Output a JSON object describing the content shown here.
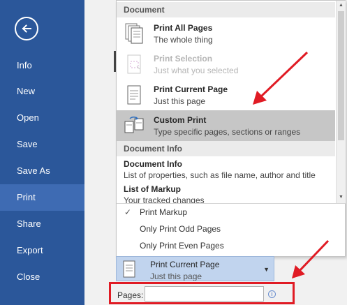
{
  "sidebar": {
    "back_label": "Back",
    "items": [
      {
        "label": "Info"
      },
      {
        "label": "New"
      },
      {
        "label": "Open"
      },
      {
        "label": "Save"
      },
      {
        "label": "Save As"
      },
      {
        "label": "Print",
        "active": true
      },
      {
        "label": "Share"
      },
      {
        "label": "Export"
      },
      {
        "label": "Close"
      }
    ]
  },
  "dropdown": {
    "sections": [
      {
        "heading": "Document",
        "options": [
          {
            "title": "Print All Pages",
            "subtitle": "The whole thing",
            "icon": "all-pages-icon"
          },
          {
            "title": "Print Selection",
            "subtitle": "Just what you selected",
            "icon": "selection-icon",
            "disabled": true
          },
          {
            "title": "Print Current Page",
            "subtitle": "Just this page",
            "icon": "current-page-icon"
          },
          {
            "title": "Custom Print",
            "subtitle": "Type specific pages, sections or ranges",
            "icon": "custom-print-icon",
            "selected": true
          }
        ]
      },
      {
        "heading": "Document Info",
        "options": [
          {
            "title": "Document Info",
            "subtitle": "List of properties, such as file name, author and title"
          },
          {
            "title": "List of Markup",
            "subtitle": "Your tracked changes"
          }
        ]
      }
    ],
    "toggles": [
      {
        "label": "Print Markup",
        "checked": true
      },
      {
        "label": "Only Print Odd Pages",
        "checked": false
      },
      {
        "label": "Only Print Even Pages",
        "checked": false
      }
    ]
  },
  "selector": {
    "title": "Print Current Page",
    "subtitle": "Just this page"
  },
  "pages": {
    "label": "Pages:",
    "value": ""
  },
  "colors": {
    "sidebar": "#2b579a",
    "sidebar_active": "#3e6bb3",
    "selected_option": "#c6c6c6",
    "selector_bg": "#c1d4ee",
    "annotation": "#e01b24"
  }
}
